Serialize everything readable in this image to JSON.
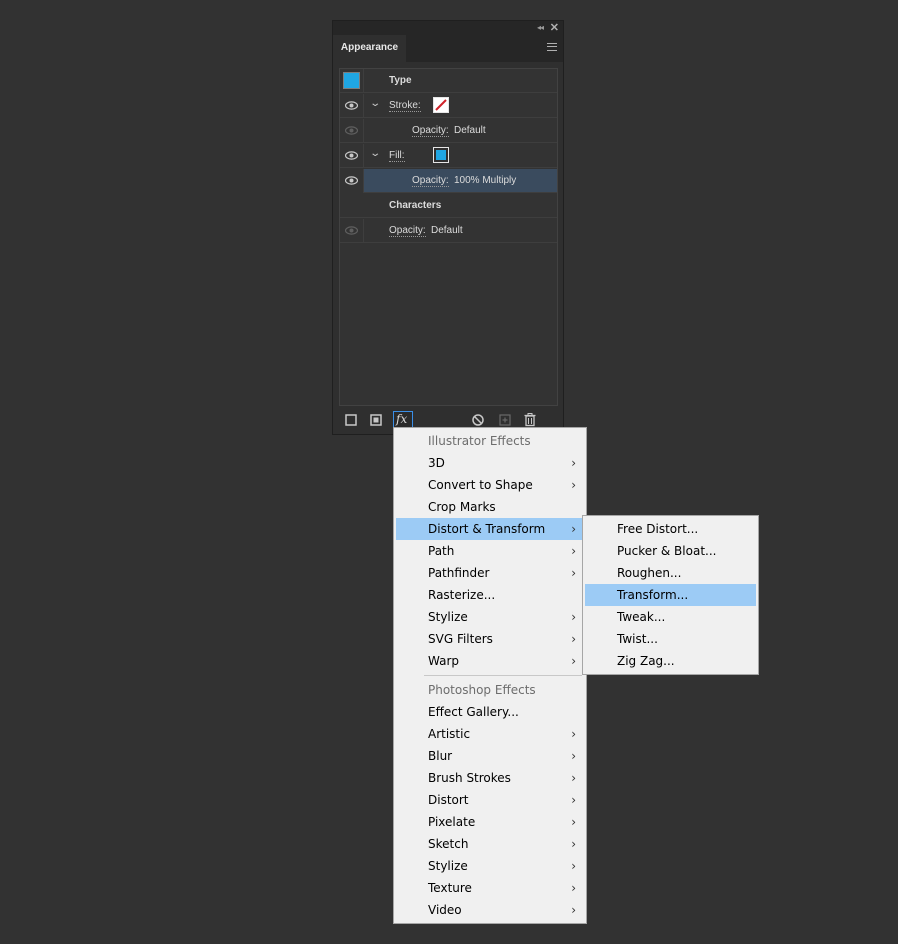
{
  "panel": {
    "tab_label": "Appearance",
    "collapse_glyph": "◂◂",
    "close_glyph": "✕",
    "rows": [
      {
        "label": "Type"
      },
      {
        "label": "Stroke:",
        "swatch": "none-red-slash"
      },
      {
        "label": "Opacity:",
        "value": "Default"
      },
      {
        "label": "Fill:",
        "swatch_color": "#1fa6e3"
      },
      {
        "label": "Opacity:",
        "value": "100% Multiply"
      },
      {
        "label": "Characters"
      },
      {
        "label": "Opacity:",
        "value": "Default"
      }
    ],
    "fill_color": "#1fa6e3",
    "fx_label": "fx"
  },
  "effects_menu": {
    "items": [
      {
        "label": "Illustrator Effects"
      },
      {
        "label": "3D"
      },
      {
        "label": "Convert to Shape"
      },
      {
        "label": "Crop Marks"
      },
      {
        "label": "Distort & Transform"
      },
      {
        "label": "Path"
      },
      {
        "label": "Pathfinder"
      },
      {
        "label": "Rasterize..."
      },
      {
        "label": "Stylize"
      },
      {
        "label": "SVG Filters"
      },
      {
        "label": "Warp"
      },
      {
        "label": "Photoshop Effects"
      },
      {
        "label": "Effect Gallery..."
      },
      {
        "label": "Artistic"
      },
      {
        "label": "Blur"
      },
      {
        "label": "Brush Strokes"
      },
      {
        "label": "Distort"
      },
      {
        "label": "Pixelate"
      },
      {
        "label": "Sketch"
      },
      {
        "label": "Stylize"
      },
      {
        "label": "Texture"
      },
      {
        "label": "Video"
      }
    ],
    "arrow_glyph": "›"
  },
  "submenu": {
    "items": [
      {
        "label": "Free Distort..."
      },
      {
        "label": "Pucker & Bloat..."
      },
      {
        "label": "Roughen..."
      },
      {
        "label": "Transform..."
      },
      {
        "label": "Tweak..."
      },
      {
        "label": "Twist..."
      },
      {
        "label": "Zig Zag..."
      }
    ]
  },
  "colors": {
    "highlight": "#9ccbf5",
    "selected_row": "#3a4b5e",
    "accent_blue": "#1fa6e3",
    "stroke_none_red": "#d0222a"
  }
}
